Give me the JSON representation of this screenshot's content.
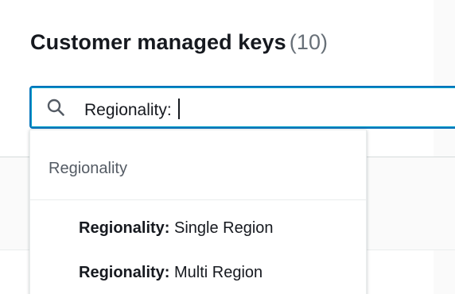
{
  "header": {
    "title": "Customer managed keys",
    "count": "(10)"
  },
  "search": {
    "icon": "search-icon",
    "value": "Regionality:"
  },
  "dropdown": {
    "group_label": "Regionality",
    "options": [
      {
        "key": "Regionality:",
        "value": "Single Region"
      },
      {
        "key": "Regionality:",
        "value": "Multi Region"
      }
    ]
  },
  "colors": {
    "focus_border": "#0073bb",
    "title_text": "#16191f",
    "count_text": "#687078",
    "group_label_text": "#545b64"
  }
}
